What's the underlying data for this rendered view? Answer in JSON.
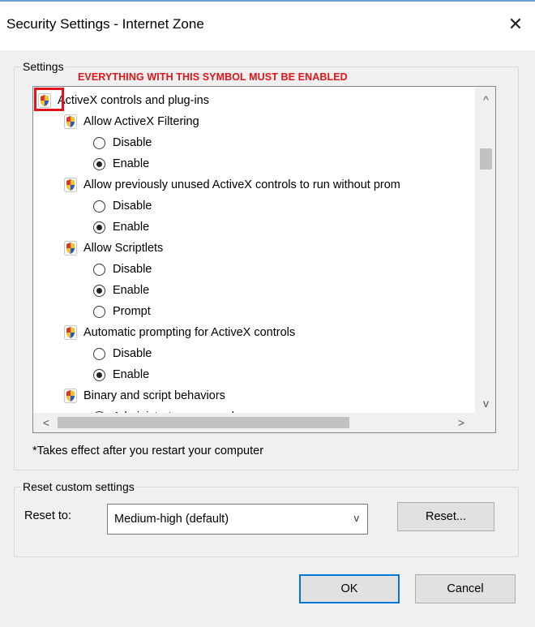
{
  "window": {
    "title": "Security Settings - Internet Zone",
    "close_glyph": "✕"
  },
  "annotation": {
    "text": "EVERYTHING WITH THIS SYMBOL MUST BE ENABLED",
    "color": "#e0141a"
  },
  "settings": {
    "legend": "Settings",
    "rows": [
      {
        "type": "category",
        "label": "ActiveX controls and plug-ins",
        "icon": "shield-icon"
      },
      {
        "type": "setting",
        "label": "Allow ActiveX Filtering",
        "icon": "shield-icon"
      },
      {
        "type": "option",
        "label": "Disable",
        "checked": false
      },
      {
        "type": "option",
        "label": "Enable",
        "checked": true
      },
      {
        "type": "setting",
        "label": "Allow previously unused ActiveX controls to run without prom",
        "icon": "shield-icon"
      },
      {
        "type": "option",
        "label": "Disable",
        "checked": false
      },
      {
        "type": "option",
        "label": "Enable",
        "checked": true
      },
      {
        "type": "setting",
        "label": "Allow Scriptlets",
        "icon": "shield-icon"
      },
      {
        "type": "option",
        "label": "Disable",
        "checked": false
      },
      {
        "type": "option",
        "label": "Enable",
        "checked": true
      },
      {
        "type": "option",
        "label": "Prompt",
        "checked": false
      },
      {
        "type": "setting",
        "label": "Automatic prompting for ActiveX controls",
        "icon": "shield-icon"
      },
      {
        "type": "option",
        "label": "Disable",
        "checked": false
      },
      {
        "type": "option",
        "label": "Enable",
        "checked": true
      },
      {
        "type": "setting",
        "label": "Binary and script behaviors",
        "icon": "shield-icon"
      },
      {
        "type": "option",
        "label": "Administrator approved",
        "checked": false
      }
    ],
    "note": "*Takes effect after you restart your computer"
  },
  "scroll": {
    "up_glyph": "^",
    "down_glyph": "v",
    "left_glyph": "<",
    "right_glyph": ">"
  },
  "reset": {
    "legend": "Reset custom settings",
    "label": "Reset to:",
    "selected": "Medium-high (default)",
    "dropdown_glyph": "v",
    "button": "Reset..."
  },
  "buttons": {
    "ok": "OK",
    "cancel": "Cancel"
  },
  "colors": {
    "accent": "#0078d7",
    "annotation_red": "#e0141a"
  }
}
